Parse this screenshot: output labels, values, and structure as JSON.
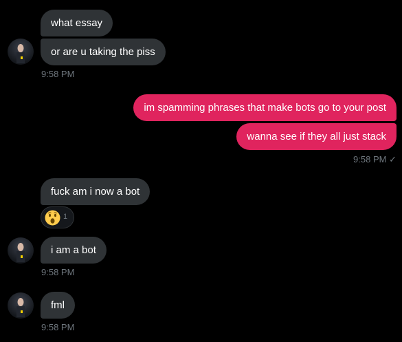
{
  "messages": {
    "m1": "what essay",
    "m2": "or are u taking the piss",
    "m3": "im spamming phrases that make bots go to your post",
    "m4": "wanna see if they all just stack",
    "m5": "fuck am i now a bot",
    "m6": "i am a bot",
    "m7": "fml"
  },
  "timestamps": {
    "t1": "9:58 PM",
    "t2": "9:58 PM",
    "t3": "9:58 PM",
    "t4": "9:58 PM"
  },
  "read_receipt": "✓",
  "reaction": {
    "icon": "surprised-face-emoji",
    "count": "1"
  },
  "colors": {
    "incoming_bubble": "#2f3336",
    "outgoing_bubble": "#e0245e",
    "timestamp": "#6e767d",
    "background": "#000000"
  }
}
